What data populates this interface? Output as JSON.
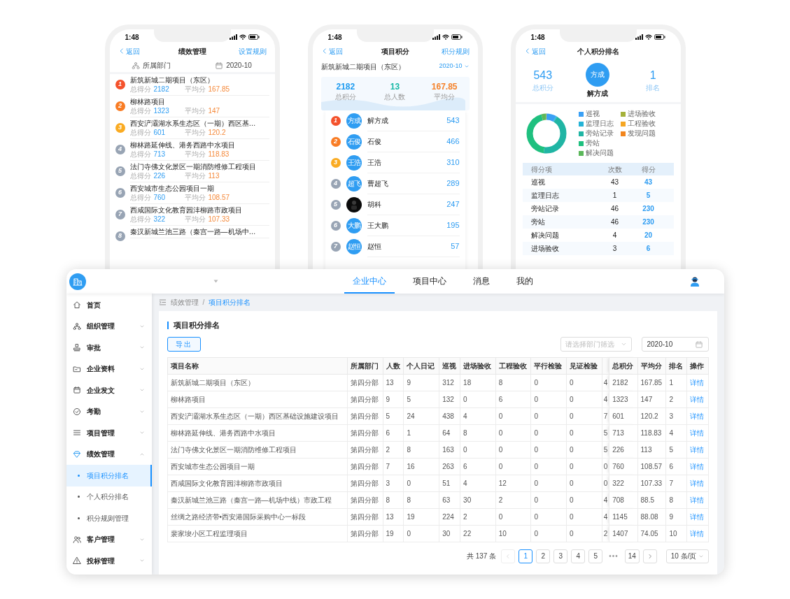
{
  "phones": [
    {
      "kind": "project_ranking",
      "time": "1:48",
      "back": "返回",
      "title": "绩效管理",
      "action": "设置规则",
      "filters": [
        {
          "kind": "dept",
          "label": "所属部门"
        },
        {
          "kind": "date",
          "label": "2020-10"
        }
      ],
      "items": [
        {
          "rank": "1",
          "name": "新筑新城二期项目（东区）",
          "total_label": "总得分",
          "total": "2182",
          "avg_label": "平均分",
          "avg": "167.85"
        },
        {
          "rank": "2",
          "name": "柳林路项目",
          "total_label": "总得分",
          "total": "1323",
          "avg_label": "平均分",
          "avg": "147"
        },
        {
          "rank": "3",
          "name": "西安浐灞湖水系生态区（一期）西区基…",
          "total_label": "总得分",
          "total": "601",
          "avg_label": "平均分",
          "avg": "120.2"
        },
        {
          "rank": "4",
          "name": "柳林路延伸线、港务西路中水项目",
          "total_label": "总得分",
          "total": "713",
          "avg_label": "平均分",
          "avg": "118.83"
        },
        {
          "rank": "5",
          "name": "法门寺佛文化景区一期消防维修工程项目",
          "total_label": "总得分",
          "total": "226",
          "avg_label": "平均分",
          "avg": "113"
        },
        {
          "rank": "6",
          "name": "西安城市生态公园项目一期",
          "total_label": "总得分",
          "total": "760",
          "avg_label": "平均分",
          "avg": "108.57"
        },
        {
          "rank": "7",
          "name": "西咸国际文化教育园沣柳路市政项目",
          "total_label": "总得分",
          "total": "322",
          "avg_label": "平均分",
          "avg": "107.33"
        },
        {
          "rank": "8",
          "name": "秦汉新城兰池三路（秦宫一路—机场中…"
        }
      ]
    },
    {
      "kind": "project_points",
      "time": "1:48",
      "back": "返回",
      "title": "项目积分",
      "action": "积分规则",
      "project": "新筑新城二期项目（东区）",
      "date": "2020-10",
      "stats": [
        {
          "value": "2182",
          "label": "总积分",
          "color": "#1e9bf0"
        },
        {
          "value": "13",
          "label": "总人数",
          "color": "#17b8a6"
        },
        {
          "value": "167.85",
          "label": "平均分",
          "color": "#f5822a"
        }
      ],
      "members": [
        {
          "rank": "1",
          "avatar": "方成",
          "name": "解方成",
          "score": "543"
        },
        {
          "rank": "2",
          "avatar": "石俊",
          "name": "石俊",
          "score": "466"
        },
        {
          "rank": "3",
          "avatar": "王浩",
          "name": "王浩",
          "score": "310"
        },
        {
          "rank": "4",
          "avatar": "超飞",
          "name": "曹超飞",
          "score": "289"
        },
        {
          "rank": "5",
          "name": "胡科",
          "score": "247"
        },
        {
          "rank": "6",
          "avatar": "大鹏",
          "name": "王大鹏",
          "score": "195"
        },
        {
          "rank": "7",
          "avatar": "赵恒",
          "name": "赵恒",
          "score": "57"
        }
      ]
    },
    {
      "kind": "personal_ranking",
      "time": "1:48",
      "back": "返回",
      "title": "个人积分排名",
      "total": "543",
      "total_label": "总积分",
      "avatar": "方成",
      "name": "解方成",
      "rank": "1",
      "rank_label": "排名",
      "legend": [
        {
          "label": "巡视",
          "color": "#3aa0f5"
        },
        {
          "label": "监理日志",
          "color": "#25b3d6"
        },
        {
          "label": "旁站记录",
          "color": "#20b5a4"
        },
        {
          "label": "旁站",
          "color": "#1fc07f"
        },
        {
          "label": "解决问题",
          "color": "#5bb75a"
        },
        {
          "label": "进场验收",
          "color": "#a5b13a"
        },
        {
          "label": "工程验收",
          "color": "#f5a623"
        },
        {
          "label": "发现问题",
          "color": "#f2851d"
        }
      ],
      "table": {
        "columns": [
          "得分项",
          "次数",
          "得分"
        ],
        "rows": [
          {
            "item": "巡视",
            "count": "43",
            "score": "43"
          },
          {
            "item": "监理日志",
            "count": "1",
            "score": "5"
          },
          {
            "item": "旁站记录",
            "count": "46",
            "score": "230"
          },
          {
            "item": "旁站",
            "count": "46",
            "score": "230"
          },
          {
            "item": "解决问题",
            "count": "4",
            "score": "20"
          },
          {
            "item": "进场验收",
            "count": "3",
            "score": "6"
          }
        ]
      }
    }
  ],
  "desktop": {
    "tabs": [
      {
        "label": "企业中心",
        "selected": true
      },
      {
        "label": "项目中心",
        "selected": false
      },
      {
        "label": "消息",
        "selected": false
      },
      {
        "label": "我的",
        "selected": false
      }
    ],
    "sidebar": {
      "items": [
        {
          "label": "首页",
          "kind": "link",
          "expanded": false
        },
        {
          "label": "组织管理",
          "kind": "group",
          "expanded": false
        },
        {
          "label": "审批",
          "kind": "group",
          "expanded": false
        },
        {
          "label": "企业资料",
          "kind": "group",
          "expanded": false
        },
        {
          "label": "企业发文",
          "kind": "group",
          "expanded": false
        },
        {
          "label": "考勤",
          "kind": "group",
          "expanded": false
        },
        {
          "label": "项目管理",
          "kind": "group",
          "expanded": false
        },
        {
          "label": "绩效管理",
          "kind": "group",
          "expanded": true,
          "children": [
            {
              "label": "项目积分排名",
              "selected": true
            },
            {
              "label": "个人积分排名",
              "selected": false
            },
            {
              "label": "积分规则管理",
              "selected": false
            }
          ]
        },
        {
          "label": "客户管理",
          "kind": "group",
          "expanded": false
        },
        {
          "label": "投标管理",
          "kind": "group",
          "expanded": false
        }
      ]
    },
    "breadcrumb": {
      "items": [
        "绩效管理",
        "项目积分排名"
      ],
      "separator": "/"
    },
    "card_title": "项目积分排名",
    "export_button": "导出",
    "dept_filter": {
      "placeholder": "请选择部门筛选"
    },
    "date_filter": {
      "value": "2020-10"
    },
    "table": {
      "columns": [
        {
          "label": "项目名称"
        },
        {
          "label": "所属部门"
        },
        {
          "label": "人数"
        },
        {
          "label": "个人日记"
        },
        {
          "label": "巡视"
        },
        {
          "label": "进场验收"
        },
        {
          "label": "工程验收"
        },
        {
          "label": "平行检验"
        },
        {
          "label": "见证检验"
        },
        {
          "kind": "cut"
        },
        {
          "label": "总积分",
          "kind": "fixed"
        },
        {
          "label": "平均分"
        },
        {
          "label": "排名"
        },
        {
          "label": "操作"
        }
      ],
      "rows": [
        {
          "cells": [
            "新筑新城二期项目（东区）",
            "第四分部",
            "13",
            "9",
            "312",
            "18",
            "8",
            "0",
            "0",
            "4",
            "2182",
            "167.85",
            "1"
          ],
          "action": "详情"
        },
        {
          "cells": [
            "柳林路项目",
            "第四分部",
            "9",
            "5",
            "132",
            "0",
            "6",
            "0",
            "0",
            "4",
            "1323",
            "147",
            "2"
          ],
          "action": "详情"
        },
        {
          "cells": [
            "西安浐灞湖水系生态区（一期）西区基础设施建设项目",
            "第四分部",
            "5",
            "24",
            "438",
            "4",
            "0",
            "0",
            "0",
            "7",
            "601",
            "120.2",
            "3"
          ],
          "action": "详情"
        },
        {
          "cells": [
            "柳林路延伸线、港务西路中水项目",
            "第四分部",
            "6",
            "1",
            "64",
            "8",
            "0",
            "0",
            "0",
            "5",
            "713",
            "118.83",
            "4"
          ],
          "action": "详情"
        },
        {
          "cells": [
            "法门寺佛文化景区一期消防维修工程项目",
            "第四分部",
            "2",
            "8",
            "163",
            "0",
            "0",
            "0",
            "0",
            "5",
            "226",
            "113",
            "5"
          ],
          "action": "详情"
        },
        {
          "cells": [
            "西安城市生态公园项目一期",
            "第四分部",
            "7",
            "16",
            "263",
            "6",
            "0",
            "0",
            "0",
            "0",
            "760",
            "108.57",
            "6"
          ],
          "action": "详情"
        },
        {
          "cells": [
            "西咸国际文化教育园沣柳路市政项目",
            "第四分部",
            "3",
            "0",
            "51",
            "4",
            "12",
            "0",
            "0",
            "0",
            "322",
            "107.33",
            "7"
          ],
          "action": "详情"
        },
        {
          "cells": [
            "秦汉新城兰池三路（秦宫一路—机场中线）市政工程",
            "第四分部",
            "8",
            "8",
            "63",
            "30",
            "2",
            "0",
            "0",
            "4",
            "708",
            "88.5",
            "8"
          ],
          "action": "详情"
        },
        {
          "cells": [
            "丝绸之路经济带•西安港国际采购中心一标段",
            "第四分部",
            "13",
            "19",
            "224",
            "2",
            "0",
            "0",
            "0",
            "4",
            "1145",
            "88.08",
            "9"
          ],
          "action": "详情"
        },
        {
          "cells": [
            "裴家埈小区工程监理项目",
            "第四分部",
            "19",
            "0",
            "30",
            "22",
            "10",
            "0",
            "0",
            "2",
            "1407",
            "74.05",
            "10"
          ],
          "action": "详情"
        }
      ]
    },
    "pagination": {
      "total": "共 137 条",
      "prev_disabled": true,
      "pages": [
        {
          "label": "1",
          "selected": true
        },
        {
          "label": "2",
          "selected": false
        },
        {
          "label": "3",
          "selected": false
        },
        {
          "label": "4",
          "selected": false
        },
        {
          "label": "5",
          "selected": false
        },
        {
          "kind": "ellipsis",
          "label": "•••"
        },
        {
          "label": "14",
          "selected": false
        }
      ],
      "page_size": "10 条/页"
    }
  }
}
